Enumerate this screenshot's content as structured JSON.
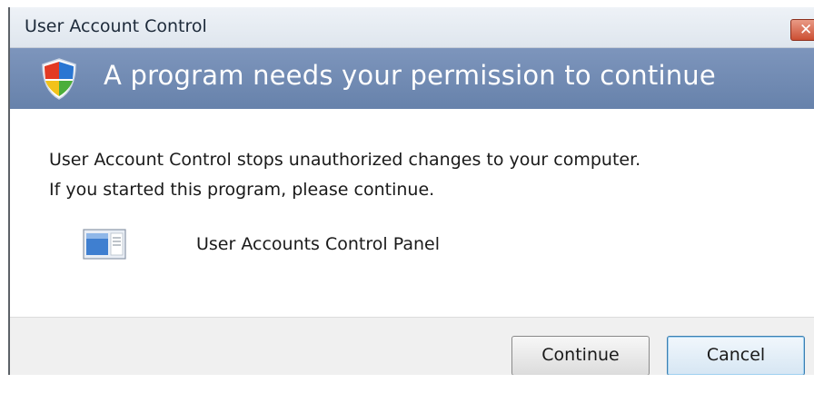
{
  "window": {
    "title": "User Account Control",
    "close_symbol": "✕"
  },
  "header": {
    "text": "A program needs your permission to continue",
    "icon": "uac-shield-icon"
  },
  "body": {
    "line1": "User Account Control stops unauthorized changes to your computer.",
    "line2": "If you started this program, please continue.",
    "program": {
      "name": "User Accounts Control Panel",
      "icon": "control-panel-icon"
    }
  },
  "buttons": {
    "continue": "Continue",
    "cancel": "Cancel"
  },
  "colors": {
    "header_band": "#7089b4",
    "close_button": "#cc4f33",
    "cancel_border": "#3c7fb1"
  }
}
